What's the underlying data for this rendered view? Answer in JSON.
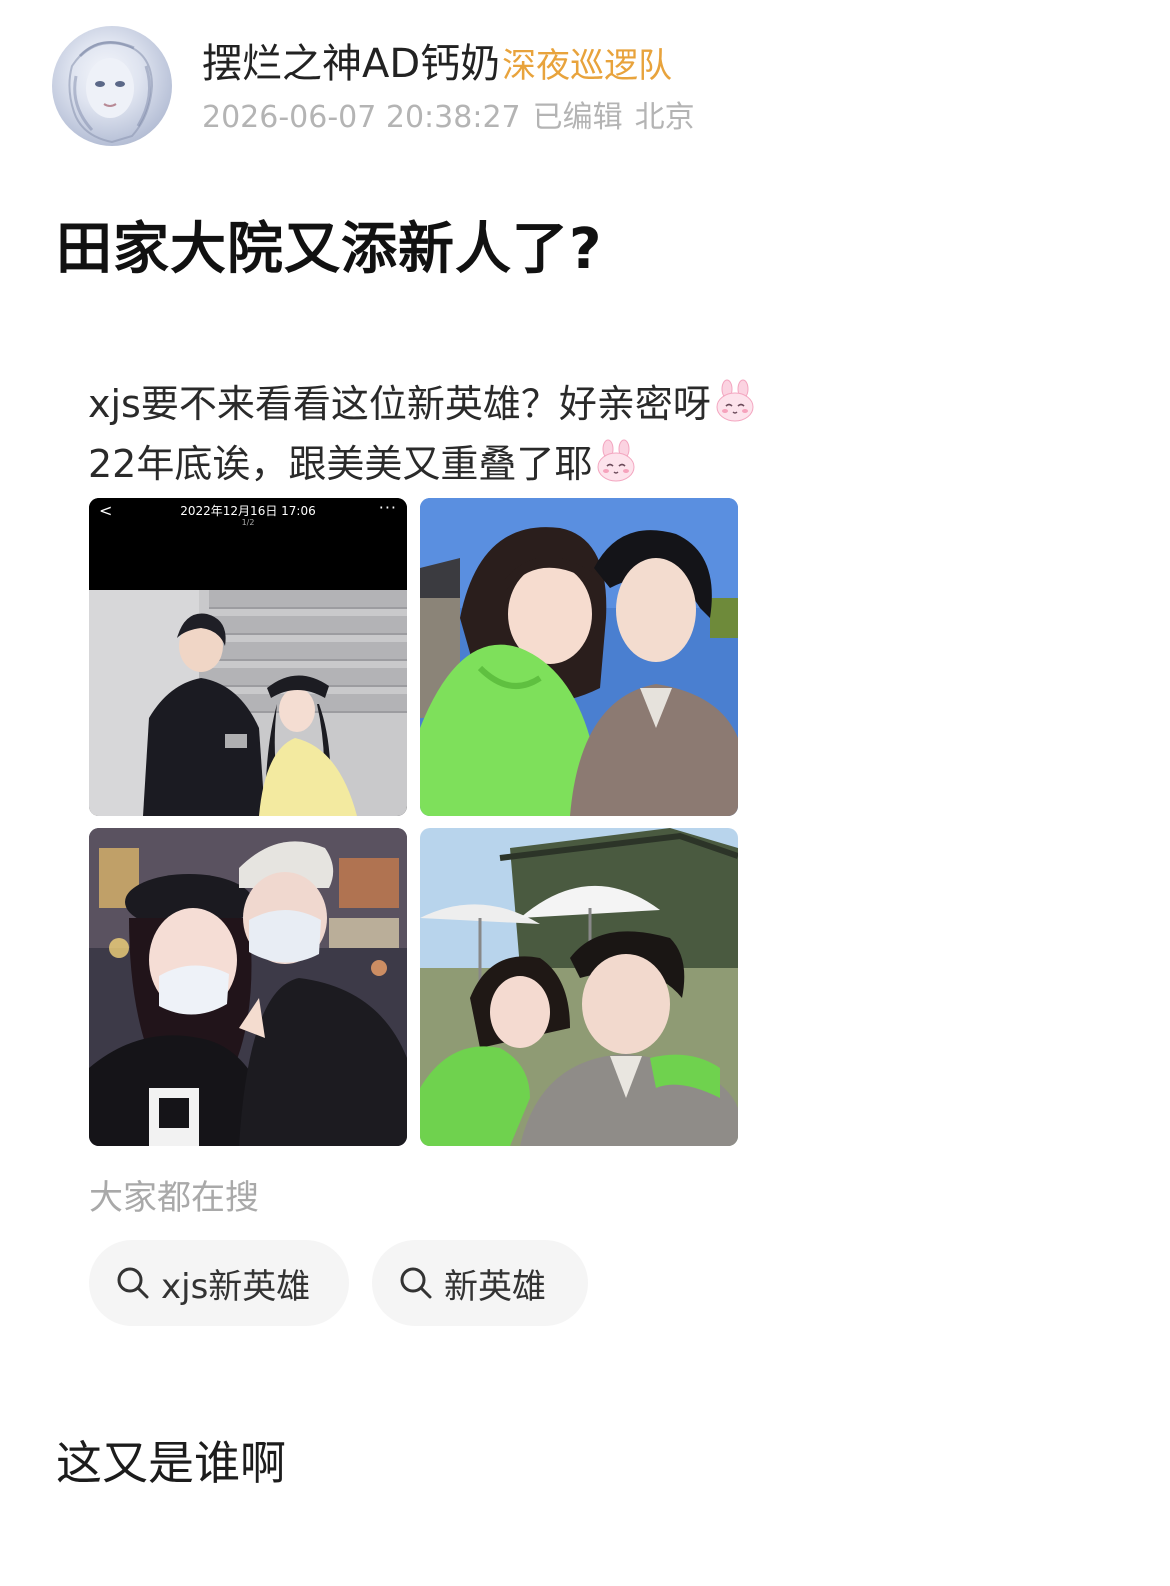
{
  "post": {
    "author": {
      "name": "摆烂之神AD钙奶",
      "tag": "深夜巡逻队"
    },
    "meta": {
      "datetime": "2026-06-07 20:38:27",
      "edited": "已编辑",
      "location": "北京"
    },
    "title": "田家大院又添新人了?",
    "body": {
      "line1": "xjs要不来看看这位新英雄？好亲密呀",
      "line2": "22年底诶，跟美美又重叠了耶"
    },
    "images": {
      "screenshot_time": "2022年12月16日 17:06",
      "screenshot_page": "1/2",
      "screenshot_back": "<",
      "screenshot_more": "···"
    },
    "search": {
      "label": "大家都在搜",
      "chips": [
        "xjs新英雄",
        "新英雄"
      ]
    },
    "footer_text": "这又是谁啊"
  },
  "colors": {
    "username": "#222222",
    "tag": "#e8a33c",
    "meta": "#b4b4b4",
    "title": "#111111",
    "chip_bg": "#f5f5f5",
    "search_label": "#a9a9a9"
  },
  "icons": {
    "bunny": "bunny-emoji-icon",
    "search": "search-icon"
  }
}
